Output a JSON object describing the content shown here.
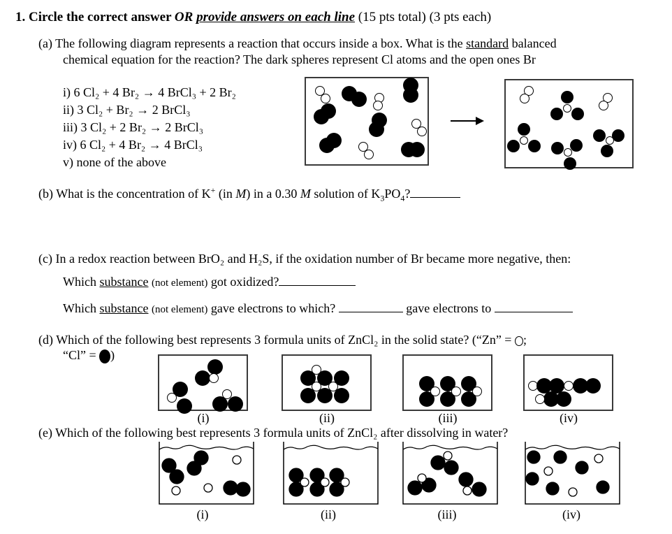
{
  "question": {
    "number": "1.",
    "title_bold": "Circle the correct answer",
    "title_or": "OR",
    "title_underlined": "provide answers on each line",
    "title_points": "(15 pts total) (3 pts each)"
  },
  "part_a": {
    "label": "(a)",
    "line1_pre": "The following diagram represents a reaction that occurs inside a box.  What is the",
    "line1_underlined": "standard",
    "line1_post": "balanced",
    "line2": "chemical equation for the reaction?  The dark spheres represent Cl atoms and the open ones Br",
    "choices": [
      {
        "id": "i)",
        "text": "6 Cl₂  +  4 Br₂  →  4 BrCl₃  +  2 Br₂"
      },
      {
        "id": "ii)",
        "text": "3 Cl₂  +  Br₂  →  2 BrCl₃"
      },
      {
        "id": "iii)",
        "text": "3 Cl₂  +  2 Br₂  →  2 BrCl₃"
      },
      {
        "id": "iv)",
        "text": "6 Cl₂  +  4 Br₂  →  4 BrCl₃"
      },
      {
        "id": "v)",
        "text": "none of the above"
      }
    ],
    "diagram": {
      "reactants": {
        "Cl2_molecules": 6,
        "Br2_molecules": 4
      },
      "products": {
        "BrCl3_molecules": 4,
        "Br2_molecules": 2
      },
      "legend": {
        "dark": "Cl",
        "open": "Br"
      }
    }
  },
  "part_b": {
    "label": "(b)",
    "text_pre": "What is the concentration of K",
    "text_sup": "+",
    "text_mid1": " (in ",
    "unit_italic": "M",
    "text_mid2": ") in a 0.30 ",
    "unit_italic2": "M",
    "text_mid3": " solution of K",
    "sub1": "3",
    "text_mid4": "PO",
    "sub2": "4",
    "text_end": "?",
    "answer": ""
  },
  "part_c": {
    "label": "(c)",
    "line1": "In a redox reaction between BrO₂ and H₂S, if the oxidation number of Br became more negative, then:",
    "q1_pre": "Which",
    "q1_underlined": "substance",
    "q1_small": "(not element)",
    "q1_post": "got oxidized?",
    "q1_answer": "",
    "q2_pre": "Which",
    "q2_underlined": "substance",
    "q2_small": "(not element)",
    "q2_post": "gave electrons to which?",
    "q2_mid": "gave electrons to",
    "q2_answer1": "",
    "q2_answer2": ""
  },
  "part_d": {
    "label": "(d)",
    "line1": "Which of the following best represents 3 formula units of ZnCl₂ in the solid state? (“Zn” = ",
    "line1_end": ";",
    "line2_pre": "“Cl” = ",
    "line2_end": ")",
    "options": [
      "(i)",
      "(ii)",
      "(iii)",
      "(iv)"
    ]
  },
  "part_e": {
    "label": "(e)",
    "line1": "Which of the following best represents 3 formula units of ZnCl₂ after dissolving in water?",
    "options": [
      "(i)",
      "(ii)",
      "(iii)",
      "(iv)"
    ]
  },
  "colors": {
    "ink": "#000000",
    "box_border": "#3a3a3a",
    "background": "#ffffff"
  }
}
